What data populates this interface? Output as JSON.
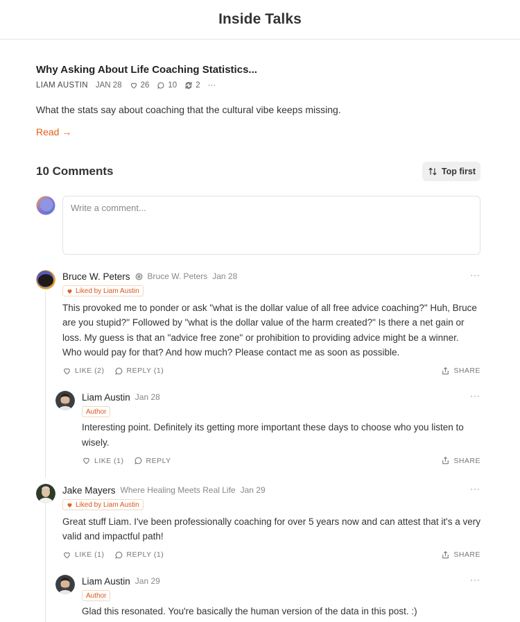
{
  "header": {
    "title": "Inside Talks"
  },
  "post": {
    "title": "Why Asking About Life Coaching Statistics...",
    "author": "LIAM AUSTIN",
    "date": "JAN 28",
    "likes": "26",
    "comments": "10",
    "restacks": "2",
    "more": "···",
    "description": "What the stats say about coaching that the cultural vibe keeps missing.",
    "read_label": "Read →"
  },
  "comments_section": {
    "heading": "10 Comments",
    "sort_label": "Top first",
    "composer_placeholder": "Write a comment...",
    "colors": {
      "accent": "#e0611a"
    },
    "items": [
      {
        "name": "Bruce W. Peters",
        "subtitle": "Bruce W. Peters",
        "date": "Jan 28",
        "badge": "Liked by Liam Austin",
        "text": "This provoked me to ponder or ask \"what is the dollar value of all free advice coaching?\" Huh, Bruce are you stupid?\" Followed by \"what is the dollar value of the harm created?\" Is there a net gain or loss. My guess is that an \"advice free zone\" or prohibition to providing advice might be a winner. Who would pay for that? And how much? Please contact me as soon as possible.",
        "like_label": "LIKE (2)",
        "reply_label": "REPLY (1)",
        "share_label": "SHARE",
        "more": "···"
      },
      {
        "name": "Liam Austin",
        "date": "Jan 28",
        "badge": "Author",
        "text": "Interesting point. Definitely its getting more important these days to choose who you listen to wisely.",
        "like_label": "LIKE (1)",
        "reply_label": "REPLY",
        "share_label": "SHARE",
        "more": "···"
      },
      {
        "name": "Jake Mayers",
        "subtitle": "Where Healing Meets Real Life",
        "date": "Jan 29",
        "badge": "Liked by Liam Austin",
        "text": "Great stuff Liam. I've been professionally coaching for over 5 years now and can attest that it's a very valid and impactful path!",
        "like_label": "LIKE (1)",
        "reply_label": "REPLY (1)",
        "share_label": "SHARE",
        "more": "···"
      },
      {
        "name": "Liam Austin",
        "date": "Jan 29",
        "badge": "Author",
        "text": "Glad this resonated. You're basically the human version of the data in this post. :)",
        "more": "···"
      }
    ]
  }
}
